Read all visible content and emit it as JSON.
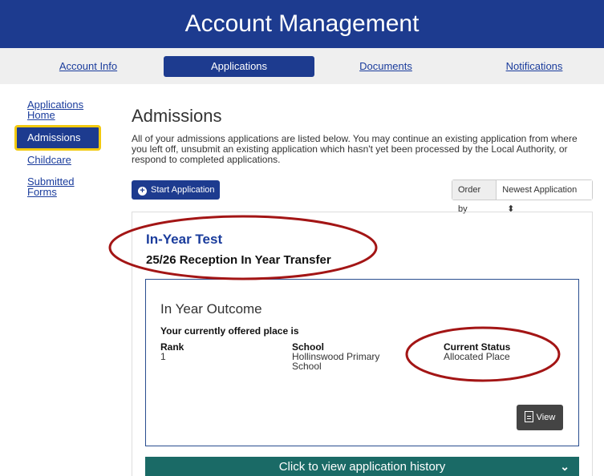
{
  "header": {
    "title": "Account Management"
  },
  "nav": {
    "items": [
      "Account Info",
      "Applications",
      "Documents",
      "Notifications"
    ],
    "active": "Applications"
  },
  "sidebar": {
    "items": [
      {
        "line1": "Applications",
        "line2": "Home"
      },
      {
        "line1": "Admissions",
        "line2": ""
      },
      {
        "line1": "Childcare",
        "line2": ""
      },
      {
        "line1": "Submitted",
        "line2": "Forms"
      }
    ],
    "active": "Admissions"
  },
  "main": {
    "title": "Admissions",
    "intro": "All of your admissions applications are listed below. You may continue an existing application from where you left off, unsubmit an existing application which hasn't yet been processed by the Local Authority, or respond to completed applications.",
    "start_button": "Start Application",
    "order_label": "Order by",
    "order_value": "Newest Application"
  },
  "application": {
    "name": "In-Year Test",
    "subtitle": "25/26 Reception In Year Transfer",
    "outcome": {
      "title": "In Year Outcome",
      "offered_label": "Your currently offered place is",
      "rank_header": "Rank",
      "rank_value": "1",
      "school_header": "School",
      "school_value_line1": "Hollinswood Primary",
      "school_value_line2": "School",
      "status_header": "Current Status",
      "status_value": "Allocated Place",
      "view_button": "View"
    },
    "history_button": "Click to view application history"
  },
  "icons": {
    "start": "plus-circle-icon",
    "view": "document-icon",
    "history": "chevron-down-icon",
    "order": "sort-icon"
  },
  "colors": {
    "brand": "#1d3b8f",
    "highlight": "#f2c90f",
    "history": "#1a6a66",
    "annotation": "#a31515"
  }
}
